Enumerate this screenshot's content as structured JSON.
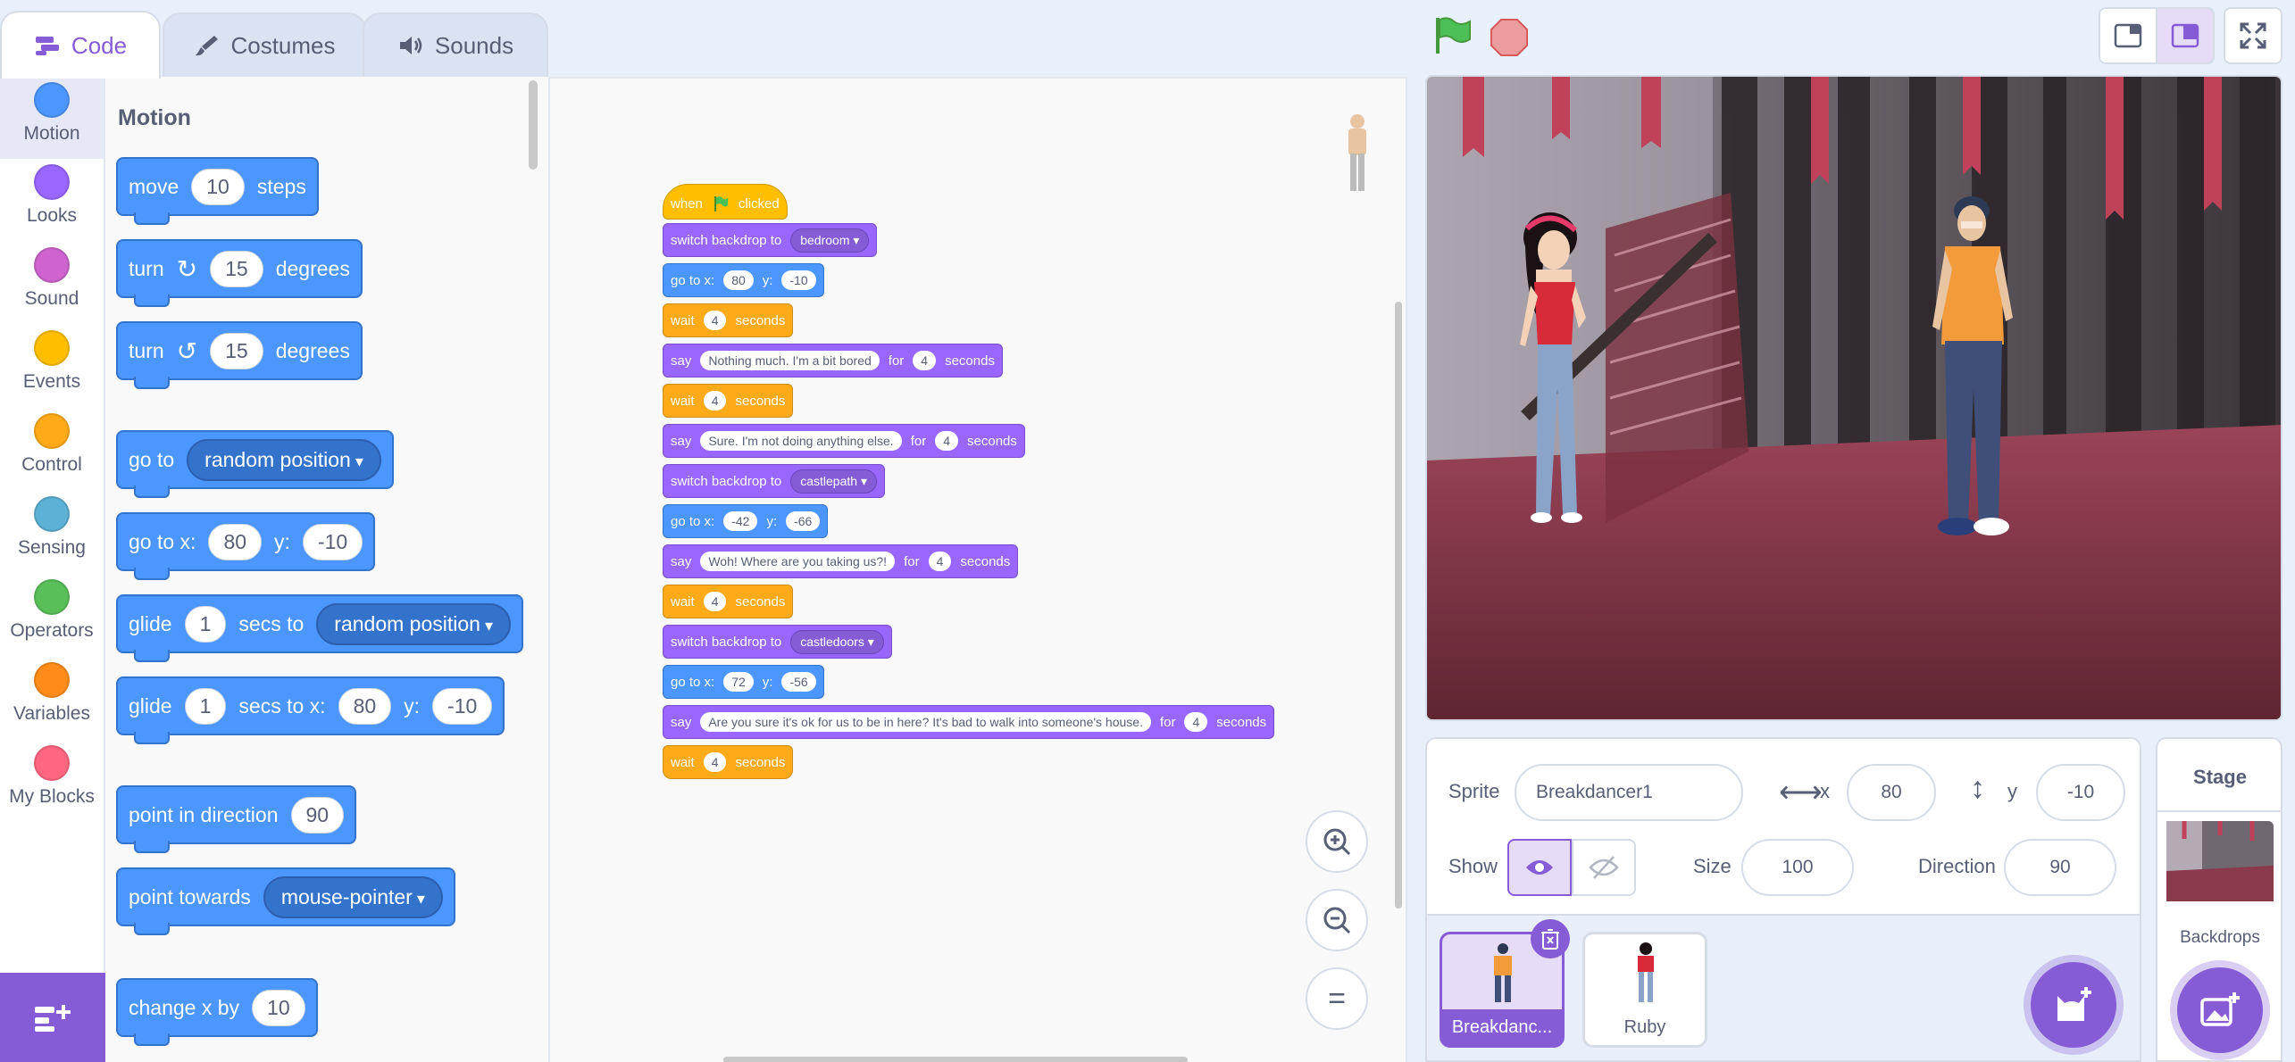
{
  "tabs": {
    "code": "Code",
    "costumes": "Costumes",
    "sounds": "Sounds"
  },
  "categories": [
    {
      "label": "Motion",
      "color": "#4c97ff"
    },
    {
      "label": "Looks",
      "color": "#9966ff"
    },
    {
      "label": "Sound",
      "color": "#cf63cf"
    },
    {
      "label": "Events",
      "color": "#ffbf00"
    },
    {
      "label": "Control",
      "color": "#ffab19"
    },
    {
      "label": "Sensing",
      "color": "#5cb1d6"
    },
    {
      "label": "Operators",
      "color": "#59c059"
    },
    {
      "label": "Variables",
      "color": "#ff8c1a"
    },
    {
      "label": "My Blocks",
      "color": "#ff6680"
    }
  ],
  "palette": {
    "heading": "Motion",
    "move": {
      "label": "move",
      "value": "10",
      "suffix": "steps"
    },
    "turn_right": {
      "label": "turn",
      "value": "15",
      "suffix": "degrees"
    },
    "turn_left": {
      "label": "turn",
      "value": "15",
      "suffix": "degrees"
    },
    "goto": {
      "label": "go to",
      "option": "random position"
    },
    "goto_xy": {
      "label": "go to x:",
      "x": "80",
      "ylabel": "y:",
      "y": "-10"
    },
    "glide": {
      "label": "glide",
      "secs": "1",
      "mid": "secs to",
      "option": "random position"
    },
    "glide_xy": {
      "label": "glide",
      "secs": "1",
      "mid": "secs to x:",
      "x": "80",
      "ylabel": "y:",
      "y": "-10"
    },
    "point_dir": {
      "label": "point in direction",
      "value": "90"
    },
    "point_towards": {
      "label": "point towards",
      "option": "mouse-pointer"
    },
    "change_x": {
      "label": "change x by",
      "value": "10"
    }
  },
  "script": {
    "hat": {
      "when": "when",
      "clicked": "clicked"
    },
    "b1": {
      "label": "switch backdrop to",
      "option": "bedroom"
    },
    "b2": {
      "label": "go to x:",
      "x": "80",
      "ylabel": "y:",
      "y": "-10"
    },
    "b3": {
      "label": "wait",
      "value": "4",
      "suffix": "seconds"
    },
    "b4": {
      "label": "say",
      "text": "Nothing much. I'm a bit bored",
      "for": "for",
      "secs": "4",
      "suffix": "seconds"
    },
    "b5": {
      "label": "wait",
      "value": "4",
      "suffix": "seconds"
    },
    "b6": {
      "label": "say",
      "text": "Sure. I'm not doing anything else.",
      "for": "for",
      "secs": "4",
      "suffix": "seconds"
    },
    "b7": {
      "label": "switch backdrop to",
      "option": "castlepath"
    },
    "b8": {
      "label": "go to x:",
      "x": "-42",
      "ylabel": "y:",
      "y": "-66"
    },
    "b9": {
      "label": "say",
      "text": "Woh! Where are you taking us?!",
      "for": "for",
      "secs": "4",
      "suffix": "seconds"
    },
    "b10": {
      "label": "wait",
      "value": "4",
      "suffix": "seconds"
    },
    "b11": {
      "label": "switch backdrop to",
      "option": "castledoors"
    },
    "b12": {
      "label": "go to x:",
      "x": "72",
      "ylabel": "y:",
      "y": "-56"
    },
    "b13": {
      "label": "say",
      "text": "Are you sure it's ok for us to be in here? It's bad to walk into someone's house.",
      "for": "for",
      "secs": "4",
      "suffix": "seconds"
    },
    "b14": {
      "label": "wait",
      "value": "4",
      "suffix": "seconds"
    }
  },
  "zoom": {
    "reset": "="
  },
  "sprite_info": {
    "sprite_label": "Sprite",
    "sprite_name": "Breakdancer1",
    "x_label": "x",
    "x": "80",
    "y_label": "y",
    "y": "-10",
    "show_label": "Show",
    "size_label": "Size",
    "size": "100",
    "direction_label": "Direction",
    "direction": "90"
  },
  "sprites": [
    {
      "name": "Breakdanc..."
    },
    {
      "name": "Ruby"
    }
  ],
  "stage_panel": {
    "title": "Stage",
    "backdrops_label": "Backdrops"
  }
}
